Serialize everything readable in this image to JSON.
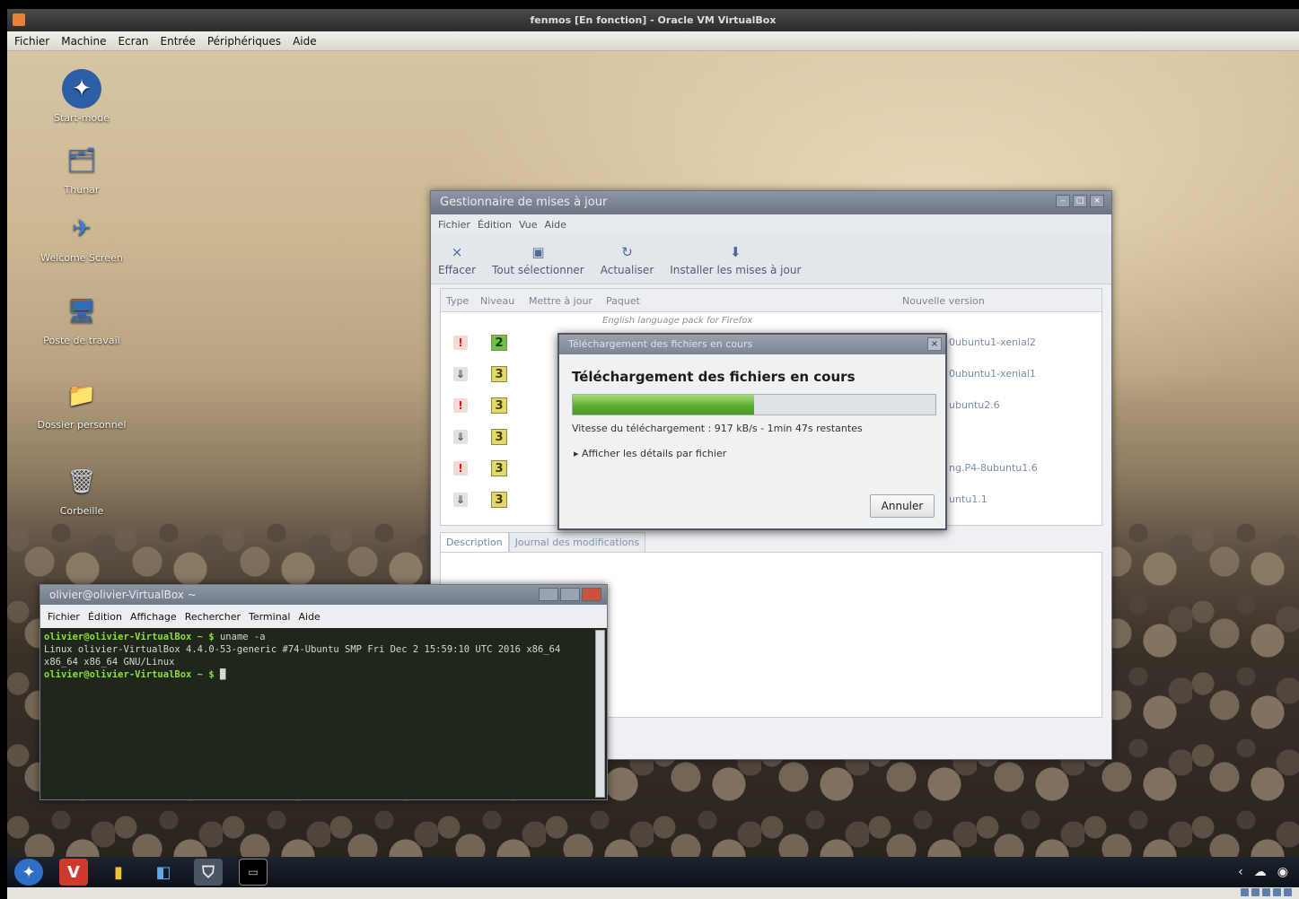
{
  "host_window": {
    "title": "fenmos [En fonction] - Oracle VM VirtualBox",
    "menu": [
      "Fichier",
      "Machine",
      "Ecran",
      "Entrée",
      "Périphériques",
      "Aide"
    ]
  },
  "desktop_icons": [
    {
      "label": "Start-mode",
      "icon": "start-icon"
    },
    {
      "label": "Thunar",
      "icon": "folder-icon"
    },
    {
      "label": "Welcome Screen",
      "icon": "bird-icon"
    },
    {
      "label": "Poste de travail",
      "icon": "computer-icon"
    },
    {
      "label": "Dossier personnel",
      "icon": "home-folder-icon"
    },
    {
      "label": "Corbeille",
      "icon": "trash-icon"
    }
  ],
  "update_manager": {
    "title": "Gestionnaire de mises à jour",
    "menu": [
      "Fichier",
      "Édition",
      "Vue",
      "Aide"
    ],
    "toolbar": [
      {
        "label": "Effacer",
        "icon": "clear-icon"
      },
      {
        "label": "Tout sélectionner",
        "icon": "select-all-icon"
      },
      {
        "label": "Actualiser",
        "icon": "refresh-icon"
      },
      {
        "label": "Installer les mises à jour",
        "icon": "install-icon"
      }
    ],
    "columns": {
      "type": "Type",
      "level": "Niveau",
      "update": "Mettre à jour",
      "package": "Paquet",
      "new_version": "Nouvelle version"
    },
    "first_row_package": "English language pack for Firefox",
    "rows": [
      {
        "type": "security",
        "type_glyph": "!",
        "level": "2",
        "version": "0ubuntu1-xenial2"
      },
      {
        "type": "bugfix",
        "type_glyph": "⇓",
        "level": "3",
        "version": "0ubuntu1-xenial1"
      },
      {
        "type": "security",
        "type_glyph": "!",
        "level": "3",
        "version": "ubuntu2.6"
      },
      {
        "type": "bugfix",
        "type_glyph": "⇓",
        "level": "3",
        "version": ""
      },
      {
        "type": "security",
        "type_glyph": "!",
        "level": "3",
        "version": "ng.P4-8ubuntu1.6"
      },
      {
        "type": "bugfix",
        "type_glyph": "⇓",
        "level": "3",
        "version": "untu1.1"
      }
    ],
    "tabs": [
      "Description",
      "Journal des modifications"
    ]
  },
  "download_dialog": {
    "title": "Téléchargement des fichiers en cours",
    "heading": "Téléchargement des fichiers en cours",
    "progress": 0.5,
    "speed_text": "Vitesse du téléchargement : 917 kB/s - 1min 47s restantes",
    "details_label": "Afficher les détails par fichier",
    "cancel_label": "Annuler"
  },
  "terminal": {
    "title": "olivier@olivier-VirtualBox ~",
    "menu": [
      "Fichier",
      "Édition",
      "Affichage",
      "Rechercher",
      "Terminal",
      "Aide"
    ],
    "prompt1": "olivier@olivier-VirtualBox ~ $",
    "command1": " uname -a",
    "output": "Linux olivier-VirtualBox 4.4.0-53-generic #74-Ubuntu SMP Fri Dec 2 15:59:10 UTC 2016 x86_64 x86_64 x86_64 GNU/Linux",
    "prompt2": "olivier@olivier-VirtualBox ~ $"
  },
  "taskbar": {
    "items": [
      "menu-icon",
      "vivaldi-icon",
      "notes-icon",
      "store-icon",
      "shield-icon",
      "terminal-icon"
    ]
  }
}
